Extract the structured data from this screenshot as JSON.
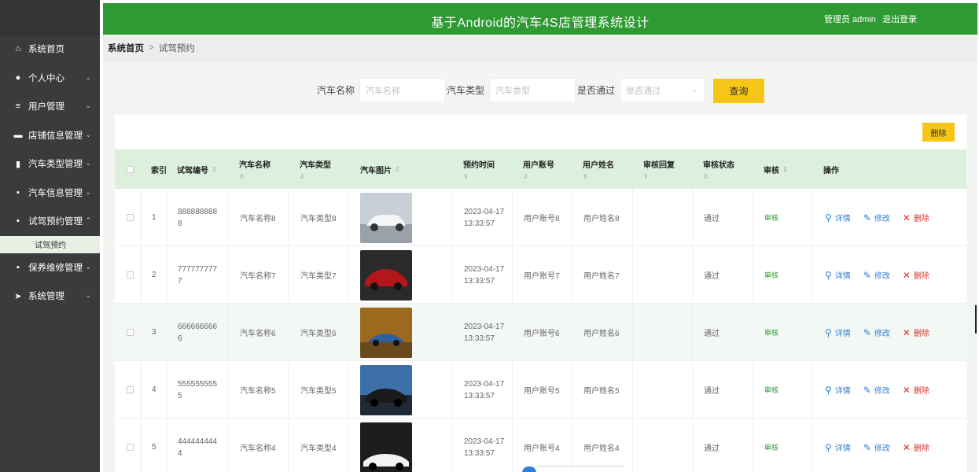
{
  "header": {
    "title": "基于Android的汽车4S店管理系统设计",
    "user_label": "管理员 admin",
    "logout_label": "退出登录"
  },
  "breadcrumb": {
    "home": "系统首页",
    "separator": ">",
    "current": "试驾预约"
  },
  "sidebar": {
    "items": [
      {
        "label": "系统首页",
        "icon": "home-icon",
        "glyph": "⌂"
      },
      {
        "label": "个人中心",
        "icon": "user-icon",
        "glyph": "●",
        "arrow": "⌄"
      },
      {
        "label": "用户管理",
        "icon": "sliders-icon",
        "glyph": "≡",
        "arrow": "⌄"
      },
      {
        "label": "店铺信息管理",
        "icon": "card-icon",
        "glyph": "▬",
        "arrow": "⌄"
      },
      {
        "label": "汽车类型管理",
        "icon": "bar-chart-icon",
        "glyph": "▮",
        "arrow": "⌄"
      },
      {
        "label": "汽车信息管理",
        "icon": "monitor-icon",
        "glyph": "▪",
        "arrow": "⌄"
      },
      {
        "label": "试驾预约管理",
        "icon": "stack-icon",
        "glyph": "▪",
        "arrow": "⌃"
      },
      {
        "label": "保养维修管理",
        "icon": "monitor-icon",
        "glyph": "▪",
        "arrow": "⌄"
      },
      {
        "label": "系统管理",
        "icon": "send-icon",
        "glyph": "➤",
        "arrow": "⌄"
      }
    ],
    "subitem": "试驾预约"
  },
  "filters": {
    "car_name": {
      "label": "汽车名称",
      "placeholder": "汽车名称"
    },
    "car_type": {
      "label": "汽车类型",
      "placeholder": "汽车类型"
    },
    "approved": {
      "label": "是否通过",
      "placeholder": "是否通过"
    },
    "query_button": "查询"
  },
  "toolbar": {
    "delete_label": "删除"
  },
  "table": {
    "headers": {
      "index": "索引",
      "code": "试驾编号",
      "name": "汽车名称",
      "type": "汽车类型",
      "image": "汽车图片",
      "time": "预约时间",
      "account": "用户账号",
      "username": "用户姓名",
      "reply": "审核回复",
      "status": "审核状态",
      "audit": "审核",
      "ops": "操作"
    },
    "sort_glyph": "⇕",
    "rows": [
      {
        "index": "1",
        "code": "8888888888",
        "name": "汽车名称8",
        "type": "汽车类型8",
        "time": "2023-04-17 13:33:57",
        "account": "用户账号8",
        "username": "用户姓名8",
        "reply": "",
        "status": "通过",
        "audit": "审核"
      },
      {
        "index": "2",
        "code": "7777777777",
        "name": "汽车名称7",
        "type": "汽车类型7",
        "time": "2023-04-17 13:33:57",
        "account": "用户账号7",
        "username": "用户姓名7",
        "reply": "",
        "status": "通过",
        "audit": "审核"
      },
      {
        "index": "3",
        "code": "6666666666",
        "name": "汽车名称6",
        "type": "汽车类型6",
        "time": "2023-04-17 13:33:57",
        "account": "用户账号6",
        "username": "用户姓名6",
        "reply": "",
        "status": "通过",
        "audit": "审核"
      },
      {
        "index": "4",
        "code": "5555555555",
        "name": "汽车名称5",
        "type": "汽车类型5",
        "time": "2023-04-17 13:33:57",
        "account": "用户账号5",
        "username": "用户姓名5",
        "reply": "",
        "status": "通过",
        "audit": "审核"
      },
      {
        "index": "5",
        "code": "4444444444",
        "name": "汽车名称4",
        "type": "汽车类型4",
        "time": "2023-04-17 13:33:57",
        "account": "用户账号4",
        "username": "用户姓名4",
        "reply": "",
        "status": "通过",
        "audit": "审核"
      }
    ],
    "ops": {
      "detail": "详情",
      "edit": "修改",
      "delete": "删除"
    }
  },
  "colors": {
    "header_green": "#2e9a31",
    "sidebar_bg": "#3b3b3b",
    "accent_yellow": "#f5c518",
    "table_head_bg": "#ddf0dd",
    "link_blue": "#2f7fd6",
    "delete_red": "#d9342b"
  }
}
